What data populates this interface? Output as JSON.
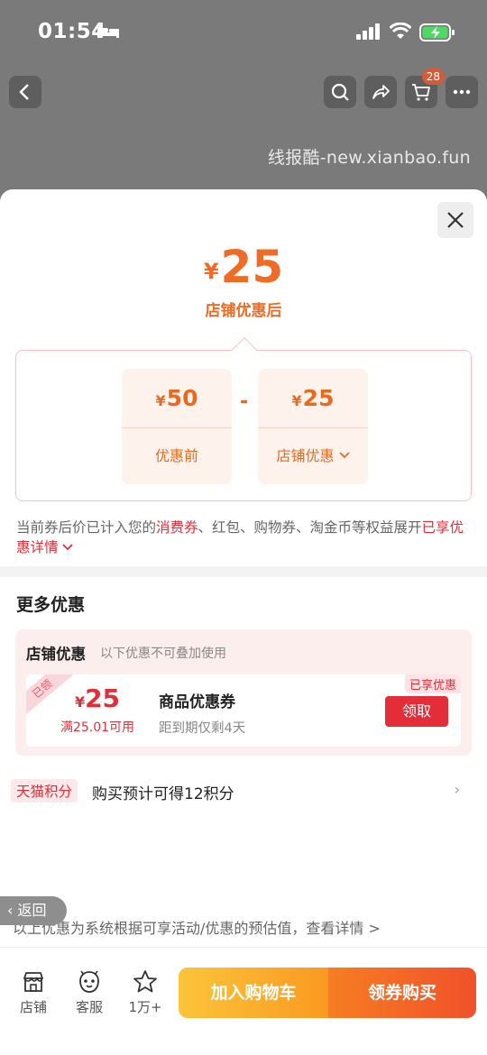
{
  "status": {
    "time": "01:54"
  },
  "nav": {
    "cart_count": "28"
  },
  "watermark": "线报酷-new.xianbao.fun",
  "hero": {
    "currency": "¥",
    "price": "25",
    "label": "店铺优惠后"
  },
  "calc": {
    "before": {
      "currency": "¥",
      "amount": "50",
      "label": "优惠前"
    },
    "operator": "-",
    "discount": {
      "currency": "¥",
      "amount": "25",
      "label": "店铺优惠"
    }
  },
  "note": {
    "part1": "当前券后价已计入您的",
    "highlight1": "消费券",
    "part2": "、红包、购物券、淘金币等权益展开",
    "highlight2": "已享优惠详情"
  },
  "more": {
    "title": "更多优惠",
    "panel_title": "店铺优惠",
    "panel_sub": "以下优惠不可叠加使用",
    "coupon": {
      "corner": "已领",
      "currency": "¥",
      "amount": "25",
      "condition": "满25.01可用",
      "name": "商品优惠券",
      "expiry": "距到期仅剩4天",
      "tag": "已享优惠",
      "button": "领取"
    },
    "tmall_tag": "天猫积分",
    "tmall_text": "购买预计可得12积分"
  },
  "back_label": "返回",
  "footer_note": "以上优惠为系统根据可享活动/优惠的预估值，查看详情 >",
  "bottom": {
    "store": "店铺",
    "service": "客服",
    "favorites": "1万+",
    "add_cart": "加入购物车",
    "buy": "领券购买"
  }
}
